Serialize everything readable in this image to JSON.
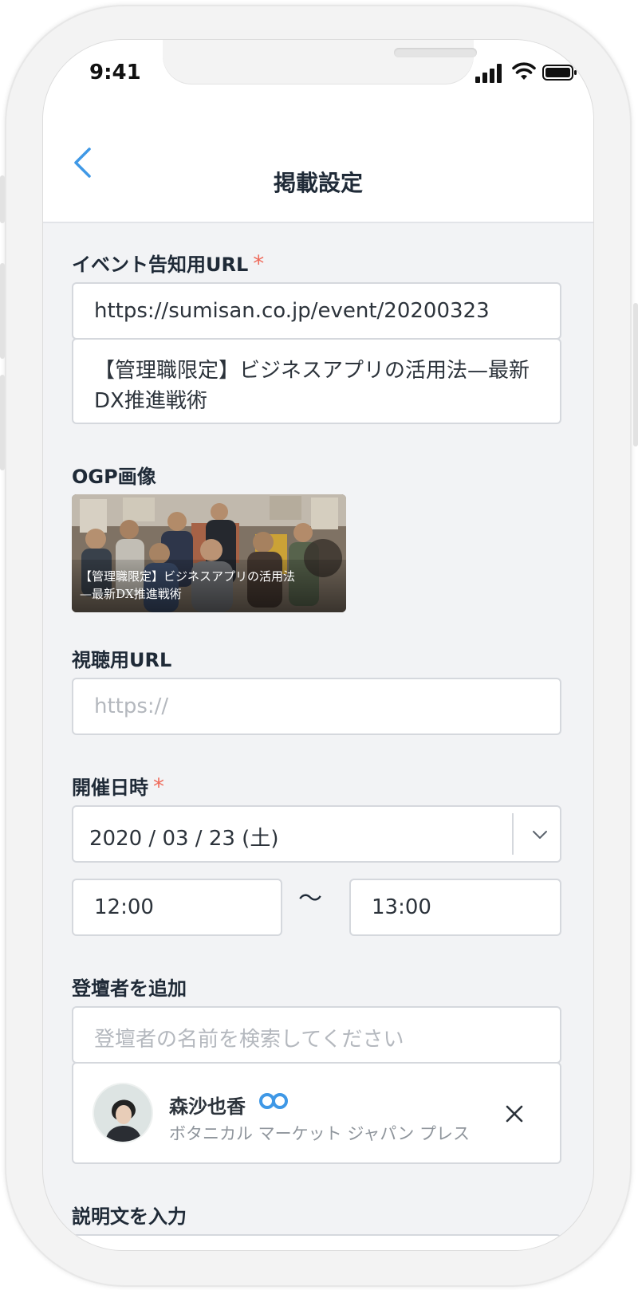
{
  "status_bar": {
    "time": "9:41"
  },
  "header": {
    "title": "掲載設定"
  },
  "event_url": {
    "label": "イベント告知用URL",
    "required_mark": "*",
    "value": "https://sumisan.co.jp/event/20200323",
    "title_line1": "【管理職限定】ビジネスアプリの活用法—最新",
    "title_line2": "DX推進戦術"
  },
  "ogp": {
    "label": "OGP画像",
    "caption_line1": "【管理職限定】ビジネスアプリの活用法",
    "caption_line2": "—最新DX推進戦術"
  },
  "viewing_url": {
    "label": "視聴用URL",
    "placeholder": "https://"
  },
  "datetime": {
    "label": "開催日時",
    "required_mark": "*",
    "date": "2020 / 03 / 23 (土)",
    "start": "12:00",
    "separator": "〜",
    "end": "13:00"
  },
  "speaker": {
    "label": "登壇者を追加",
    "search_placeholder": "登壇者の名前を検索してください",
    "selected": {
      "name": "森沙也香",
      "company": "ボタニカル マーケット ジャパン プレス"
    }
  },
  "description": {
    "label": "説明文を入力"
  },
  "colors": {
    "accent": "#3f98e6",
    "required": "#ef6a5a",
    "background": "#f2f3f5",
    "border": "#d5d8dd"
  }
}
